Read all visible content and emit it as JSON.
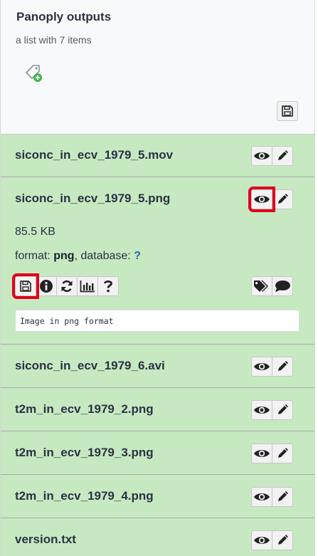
{
  "history": {
    "title": "Panoply outputs",
    "subtitle": "a list with 7 items"
  },
  "items": [
    {
      "name": "siconc_in_ecv_1979_5.mov"
    },
    {
      "name": "siconc_in_ecv_1979_5.png",
      "size": "85.5 KB",
      "format_label": "format:",
      "format": "png",
      "database_label": ", database:",
      "database": "?",
      "peek": "Image in png format"
    },
    {
      "name": "siconc_in_ecv_1979_6.avi"
    },
    {
      "name": "t2m_in_ecv_1979_2.png"
    },
    {
      "name": "t2m_in_ecv_1979_3.png"
    },
    {
      "name": "t2m_in_ecv_1979_4.png"
    },
    {
      "name": "version.txt"
    }
  ],
  "icons": {
    "view": "eye-icon",
    "edit": "pencil-icon",
    "save": "floppy-disk-icon",
    "info": "info-circle-icon",
    "rerun": "refresh-icon",
    "visualize": "bar-chart-icon",
    "help": "question-icon",
    "tags": "tags-icon",
    "annotate": "comment-icon",
    "add_tag": "tag-add-icon"
  },
  "colors": {
    "item_bg": "#c6e9c1",
    "header_bg": "#f8f9fa",
    "highlight": "#e0001b",
    "text": "#2c3143"
  }
}
